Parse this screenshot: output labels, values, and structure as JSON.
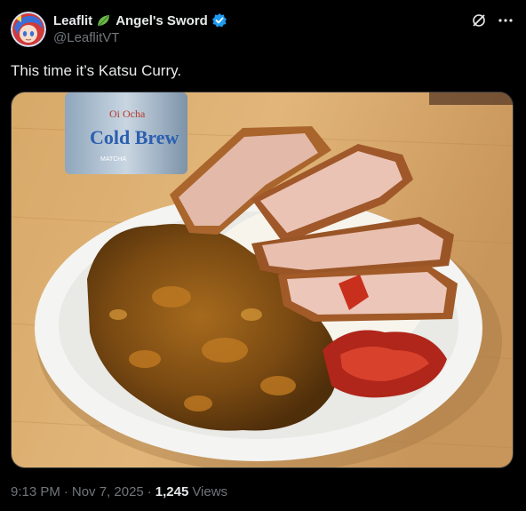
{
  "post": {
    "display_name": "Leaflit",
    "display_name_suffix": "Angel's Sword",
    "handle": "@LeaflitVT",
    "text": "This time it’s Katsu Curry.",
    "time": "9:13 PM",
    "date": "Nov 7, 2025",
    "views_count": "1,245",
    "views_label": "Views",
    "separator": "·"
  },
  "photo": {
    "can_text_line1": "Oi Ocha",
    "can_text_line2": "Cold Brew",
    "can_text_line3": "MATCHA"
  },
  "colors": {
    "verified": "#1d9bf0",
    "secondary_text": "#71767b",
    "primary_text": "#e7e9ea"
  },
  "icons": [
    "leaf-emoji-icon",
    "verified-badge-icon",
    "grok-icon",
    "more-icon"
  ]
}
